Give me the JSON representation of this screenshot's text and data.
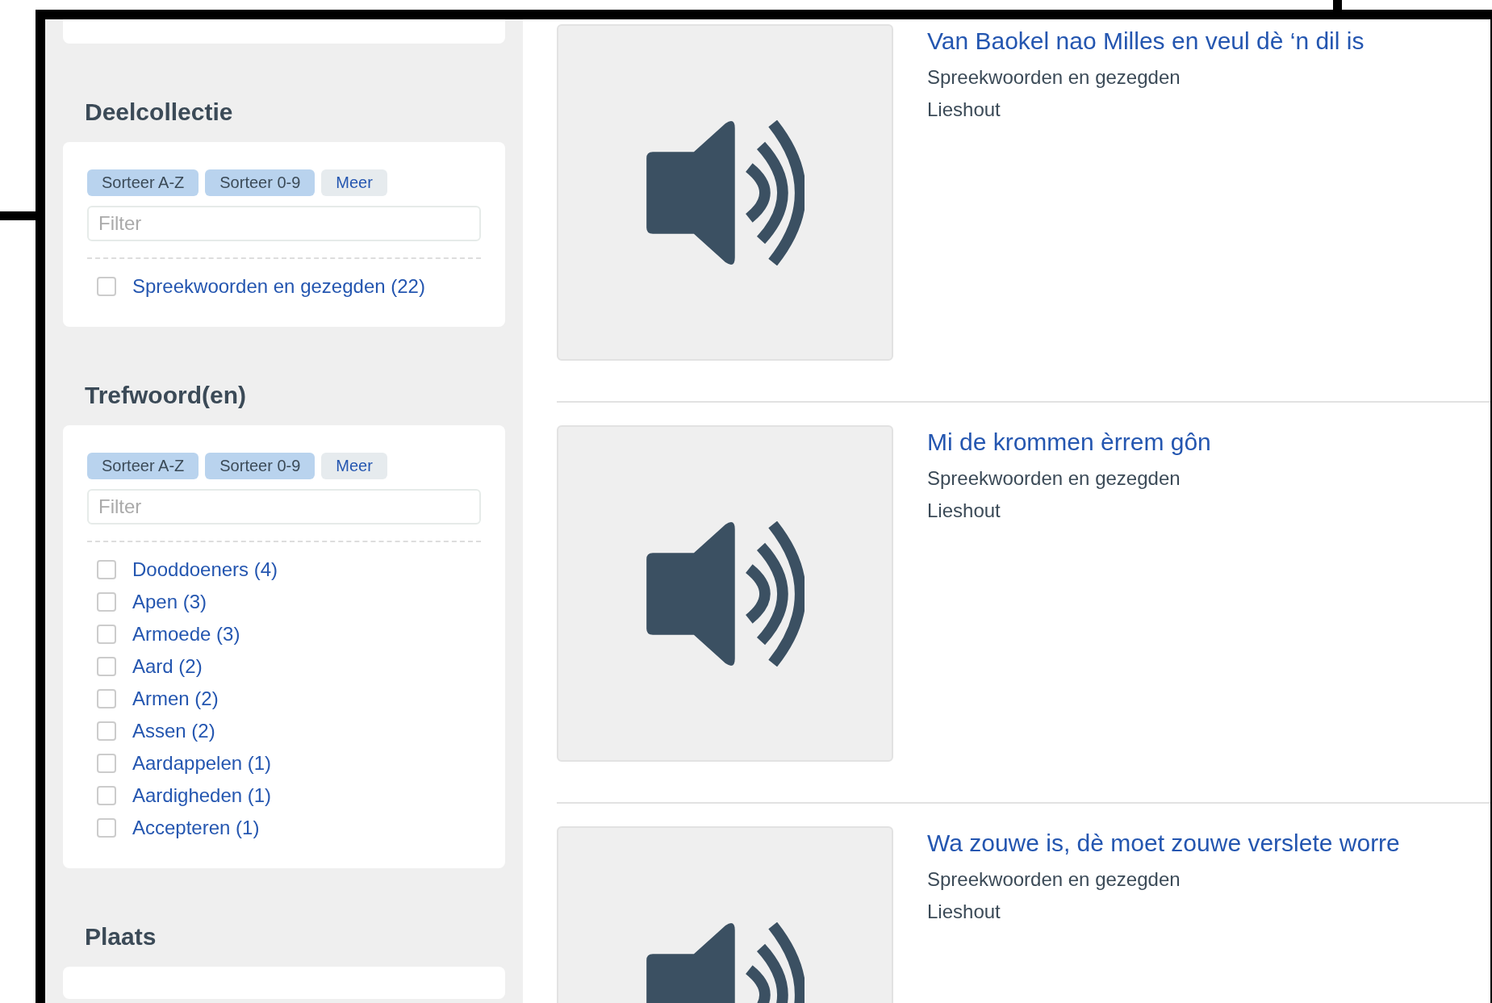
{
  "sidebar": {
    "sections": [
      {
        "heading": "Deelcollectie",
        "buttons": [
          {
            "label": "Sorteer A-Z",
            "kind": "sort"
          },
          {
            "label": "Sorteer 0-9",
            "kind": "sort"
          },
          {
            "label": "Meer",
            "kind": "more"
          }
        ],
        "filter": {
          "placeholder": "Filter"
        },
        "items": [
          {
            "label": "Spreekwoorden en gezegden (22)",
            "checked": false
          }
        ]
      },
      {
        "heading": "Trefwoord(en)",
        "buttons": [
          {
            "label": "Sorteer A-Z",
            "kind": "sort"
          },
          {
            "label": "Sorteer 0-9",
            "kind": "sort"
          },
          {
            "label": "Meer",
            "kind": "more"
          }
        ],
        "filter": {
          "placeholder": "Filter"
        },
        "items": [
          {
            "label": "Dooddoeners (4)",
            "checked": false
          },
          {
            "label": "Apen (3)",
            "checked": false
          },
          {
            "label": "Armoede (3)",
            "checked": false
          },
          {
            "label": "Aard (2)",
            "checked": false
          },
          {
            "label": "Armen (2)",
            "checked": false
          },
          {
            "label": "Assen (2)",
            "checked": false
          },
          {
            "label": "Aardappelen (1)",
            "checked": false
          },
          {
            "label": "Aardigheden (1)",
            "checked": false
          },
          {
            "label": "Accepteren (1)",
            "checked": false
          }
        ]
      },
      {
        "heading": "Plaats"
      }
    ]
  },
  "results": [
    {
      "title": "Van Baokel nao Milles en veul dè ‘n dil is",
      "category": "Spreekwoorden en gezegden",
      "place": "Lieshout"
    },
    {
      "title": "Mi de krommen èrrem gôn",
      "category": "Spreekwoorden en gezegden",
      "place": "Lieshout"
    },
    {
      "title": "Wa zouwe is, dè moet zouwe verslete worre",
      "category": "Spreekwoorden en gezegden",
      "place": "Lieshout"
    }
  ]
}
